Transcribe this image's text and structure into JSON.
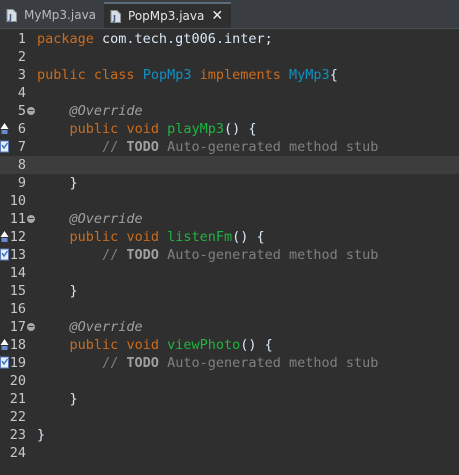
{
  "tabs": [
    {
      "label": "MyMp3.java",
      "active": false,
      "icon": "java-file-icon"
    },
    {
      "label": "PopMp3.java",
      "active": true,
      "icon": "java-file-icon",
      "close": "✕"
    }
  ],
  "colors": {
    "keyword": "#cc6c1d",
    "annotation": "#a0a0a0",
    "class_name": "#1290c3",
    "method": "#1eb540",
    "comment": "#808080",
    "text": "#d9e8f7",
    "background": "#2f2f2f"
  },
  "lines": [
    {
      "n": "1",
      "segs": [
        {
          "t": "package",
          "c": "kw"
        },
        {
          "t": " com.tech.gt006.inter;",
          "c": "plain"
        }
      ]
    },
    {
      "n": "2",
      "segs": []
    },
    {
      "n": "3",
      "segs": [
        {
          "t": "public",
          "c": "kw"
        },
        {
          "t": " ",
          "c": "plain"
        },
        {
          "t": "class",
          "c": "kw"
        },
        {
          "t": " ",
          "c": "plain"
        },
        {
          "t": "PopMp3",
          "c": "cls"
        },
        {
          "t": " ",
          "c": "plain"
        },
        {
          "t": "implements",
          "c": "kw"
        },
        {
          "t": " ",
          "c": "plain"
        },
        {
          "t": "MyMp3",
          "c": "cls"
        },
        {
          "t": "{",
          "c": "plain"
        }
      ]
    },
    {
      "n": "4",
      "segs": []
    },
    {
      "n": "5",
      "fold": "−",
      "segs": [
        {
          "t": "    ",
          "c": "plain"
        },
        {
          "t": "@Override",
          "c": "ann"
        }
      ]
    },
    {
      "n": "6",
      "marker": "override",
      "segs": [
        {
          "t": "    ",
          "c": "plain"
        },
        {
          "t": "public",
          "c": "kw"
        },
        {
          "t": " ",
          "c": "plain"
        },
        {
          "t": "void",
          "c": "kw"
        },
        {
          "t": " ",
          "c": "plain"
        },
        {
          "t": "playMp3",
          "c": "mth"
        },
        {
          "t": "() {",
          "c": "plain"
        }
      ]
    },
    {
      "n": "7",
      "marker": "task",
      "segs": [
        {
          "t": "        ",
          "c": "plain"
        },
        {
          "t": "// ",
          "c": "cmt"
        },
        {
          "t": "TODO",
          "c": "todo"
        },
        {
          "t": " Auto-generated method stub",
          "c": "cmt"
        }
      ]
    },
    {
      "n": "8",
      "current": true,
      "segs": []
    },
    {
      "n": "9",
      "segs": [
        {
          "t": "    }",
          "c": "plain"
        }
      ]
    },
    {
      "n": "10",
      "segs": []
    },
    {
      "n": "11",
      "fold": "−",
      "segs": [
        {
          "t": "    ",
          "c": "plain"
        },
        {
          "t": "@Override",
          "c": "ann"
        }
      ]
    },
    {
      "n": "12",
      "marker": "override",
      "segs": [
        {
          "t": "    ",
          "c": "plain"
        },
        {
          "t": "public",
          "c": "kw"
        },
        {
          "t": " ",
          "c": "plain"
        },
        {
          "t": "void",
          "c": "kw"
        },
        {
          "t": " ",
          "c": "plain"
        },
        {
          "t": "listenFm",
          "c": "mth"
        },
        {
          "t": "() {",
          "c": "plain"
        }
      ]
    },
    {
      "n": "13",
      "marker": "task",
      "segs": [
        {
          "t": "        ",
          "c": "plain"
        },
        {
          "t": "// ",
          "c": "cmt"
        },
        {
          "t": "TODO",
          "c": "todo"
        },
        {
          "t": " Auto-generated method stub",
          "c": "cmt"
        }
      ]
    },
    {
      "n": "14",
      "segs": []
    },
    {
      "n": "15",
      "segs": [
        {
          "t": "    }",
          "c": "plain"
        }
      ]
    },
    {
      "n": "16",
      "segs": []
    },
    {
      "n": "17",
      "fold": "−",
      "segs": [
        {
          "t": "    ",
          "c": "plain"
        },
        {
          "t": "@Override",
          "c": "ann"
        }
      ]
    },
    {
      "n": "18",
      "marker": "override",
      "segs": [
        {
          "t": "    ",
          "c": "plain"
        },
        {
          "t": "public",
          "c": "kw"
        },
        {
          "t": " ",
          "c": "plain"
        },
        {
          "t": "void",
          "c": "kw"
        },
        {
          "t": " ",
          "c": "plain"
        },
        {
          "t": "viewPhoto",
          "c": "mth"
        },
        {
          "t": "() {",
          "c": "plain"
        }
      ]
    },
    {
      "n": "19",
      "marker": "task",
      "segs": [
        {
          "t": "        ",
          "c": "plain"
        },
        {
          "t": "// ",
          "c": "cmt"
        },
        {
          "t": "TODO",
          "c": "todo"
        },
        {
          "t": " Auto-generated method stub",
          "c": "cmt"
        }
      ]
    },
    {
      "n": "20",
      "segs": []
    },
    {
      "n": "21",
      "segs": [
        {
          "t": "    }",
          "c": "plain"
        }
      ]
    },
    {
      "n": "22",
      "segs": []
    },
    {
      "n": "23",
      "segs": [
        {
          "t": "}",
          "c": "plain"
        }
      ]
    },
    {
      "n": "24",
      "segs": []
    }
  ]
}
